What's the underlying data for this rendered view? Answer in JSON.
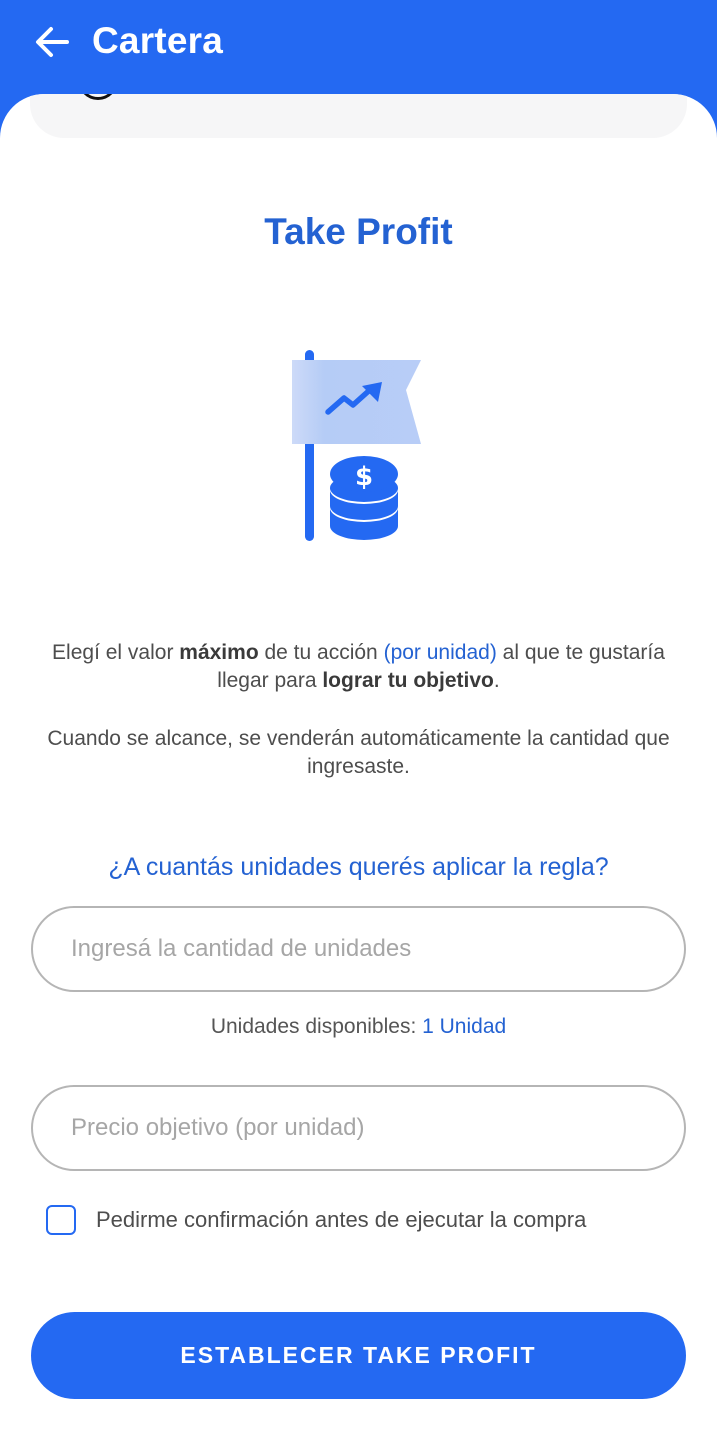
{
  "header": {
    "title": "Cartera",
    "back_icon": "arrow-left-icon",
    "color": "#2469f2"
  },
  "main": {
    "title": "Take Profit",
    "illustration": "flag-chart-coins-icon",
    "description1": {
      "p1": "Elegí el valor ",
      "b1": "máximo",
      "p2": " de tu acción ",
      "link": "(por unidad)",
      "p3": " al que te gustaría llegar para ",
      "b2": "lograr tu objetivo",
      "p4": "."
    },
    "description2": "Cuando se alcance, se venderán automáticamente la cantidad que ingresaste.",
    "question": "¿A cuantás unidades querés aplicar la regla?",
    "units_input": {
      "placeholder": "Ingresá la cantidad de unidades",
      "value": ""
    },
    "available": {
      "label": "Unidades disponibles: ",
      "value": "1 Unidad"
    },
    "price_input": {
      "placeholder": "Precio objetivo (por unidad)",
      "value": ""
    },
    "confirm_checkbox": {
      "label": "Pedirme confirmación antes de ejecutar la compra",
      "checked": false
    },
    "submit_label": "ESTABLECER TAKE PROFIT"
  },
  "colors": {
    "primary": "#2469f2",
    "link": "#2462d2",
    "text": "#4d4d4d",
    "placeholder": "#a6a6a6"
  }
}
